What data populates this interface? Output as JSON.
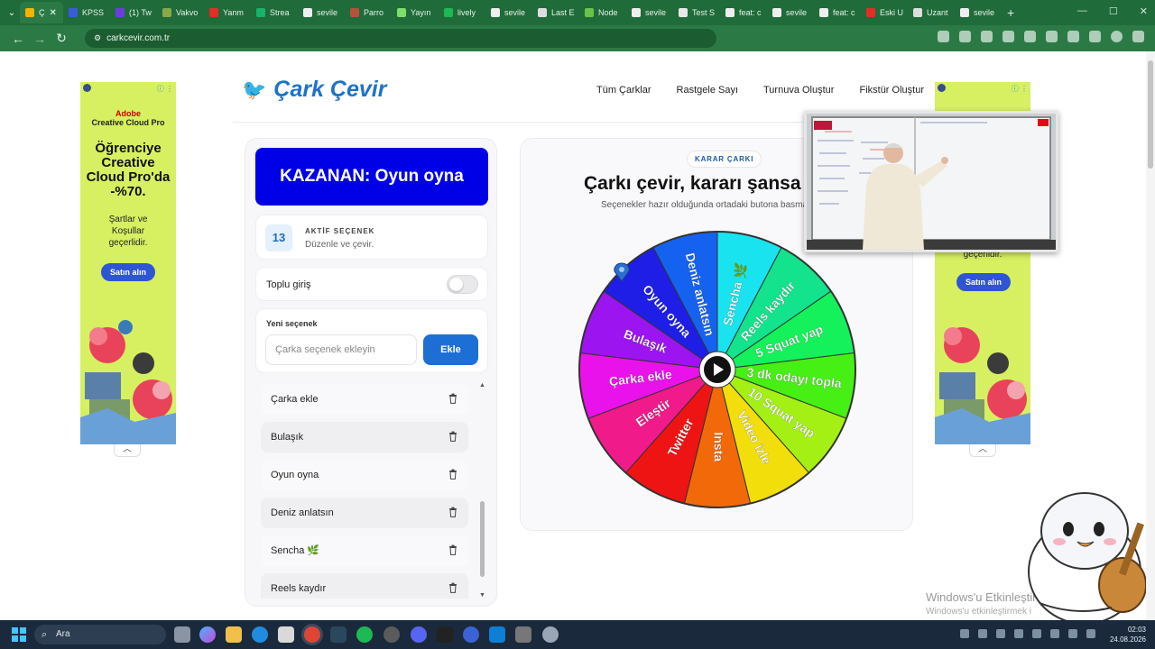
{
  "browser": {
    "tabs": [
      {
        "label": "Ç",
        "color": "#f4b400",
        "active": true
      },
      {
        "label": "KPSS",
        "color": "#3b5bdb"
      },
      {
        "label": "(1) Tw",
        "color": "#6c3ce0"
      },
      {
        "label": "Vakvo",
        "color": "#8aa84a"
      },
      {
        "label": "Yanm",
        "color": "#e52d27"
      },
      {
        "label": "Strea",
        "color": "#18b26b"
      },
      {
        "label": "sevile",
        "color": "#eeeeee"
      },
      {
        "label": "Parro",
        "color": "#b5523b"
      },
      {
        "label": "Yayın",
        "color": "#7ddc6a"
      },
      {
        "label": "lively",
        "color": "#1db954"
      },
      {
        "label": "sevile",
        "color": "#eeeeee"
      },
      {
        "label": "Last E",
        "color": "#dddddd"
      },
      {
        "label": "Node",
        "color": "#6cc24a"
      },
      {
        "label": "sevile",
        "color": "#eeeeee"
      },
      {
        "label": "Test S",
        "color": "#e8e8e8"
      },
      {
        "label": "feat: c",
        "color": "#eeeeee"
      },
      {
        "label": "sevile",
        "color": "#eeeeee"
      },
      {
        "label": "feat: c",
        "color": "#eeeeee"
      },
      {
        "label": "Eski U",
        "color": "#e52d27"
      },
      {
        "label": "Uzant",
        "color": "#dddddd"
      },
      {
        "label": "sevile",
        "color": "#eeeeee"
      }
    ],
    "close_glyph": "✕",
    "new_tab_glyph": "+",
    "url": "carkcevir.com.tr"
  },
  "header": {
    "logo": "Çark Çevir",
    "nav": [
      "Tüm Çarklar",
      "Rastgele Sayı",
      "Turnuva Oluştur",
      "Fikstür Oluştur"
    ]
  },
  "ad": {
    "brand1": "Adobe",
    "brand2": "Creative Cloud Pro",
    "headline": "Öğrenciye Creative Cloud Pro'da -%70.",
    "sub": "Şartlar ve Koşullar geçerlidir.",
    "buy": "Satın alın",
    "right_sub": "geçerlidir."
  },
  "left": {
    "winner": "KAZANAN: Oyun oyna",
    "count": "13",
    "count_title": "AKTİF SEÇENEK",
    "count_sub": "Düzenle ve çevir.",
    "bulk_label": "Toplu giriş",
    "bulk_on": false,
    "new_label": "Yeni seçenek",
    "input_placeholder": "Çarka seçenek ekleyin",
    "add_label": "Ekle",
    "options": [
      "Çarka ekle",
      "Bulaşık",
      "Oyun oyna",
      "Deniz anlatsın",
      "Sencha 🌿",
      "Reels kaydır"
    ]
  },
  "wheel": {
    "kicker": "KARAR ÇARKI",
    "title": "Çarkı çevir, kararı şansa b",
    "desc": "Seçenekler hazır olduğunda ortadaki butona basman",
    "segments": [
      {
        "label": "Sencha 🌿",
        "color": "#19e3ef"
      },
      {
        "label": "Reels kaydır",
        "color": "#12e38c"
      },
      {
        "label": "5 Squat yap",
        "color": "#14f15a"
      },
      {
        "label": "3 dk odayı topla",
        "color": "#46ef14"
      },
      {
        "label": "10 Squat yap",
        "color": "#a4f015"
      },
      {
        "label": "Video izle",
        "color": "#f2de0a"
      },
      {
        "label": "Insta",
        "color": "#f2690a"
      },
      {
        "label": "Twitter",
        "color": "#ee1414"
      },
      {
        "label": "Eleştir",
        "color": "#f01a8a"
      },
      {
        "label": "Çarka ekle",
        "color": "#ea12ea"
      },
      {
        "label": "Bulaşık",
        "color": "#9c14f0"
      },
      {
        "label": "Oyun oyna",
        "color": "#1e1ee6"
      },
      {
        "label": "Deniz anlatsın",
        "color": "#1662f0"
      }
    ]
  },
  "overlay": {
    "watermark": "Windows'u Etkinleştir",
    "watermark_sub": "Windows'u etkinleştirmek i"
  },
  "taskbar": {
    "search": "Ara",
    "time": "02:03",
    "date": "24.08.2026"
  }
}
